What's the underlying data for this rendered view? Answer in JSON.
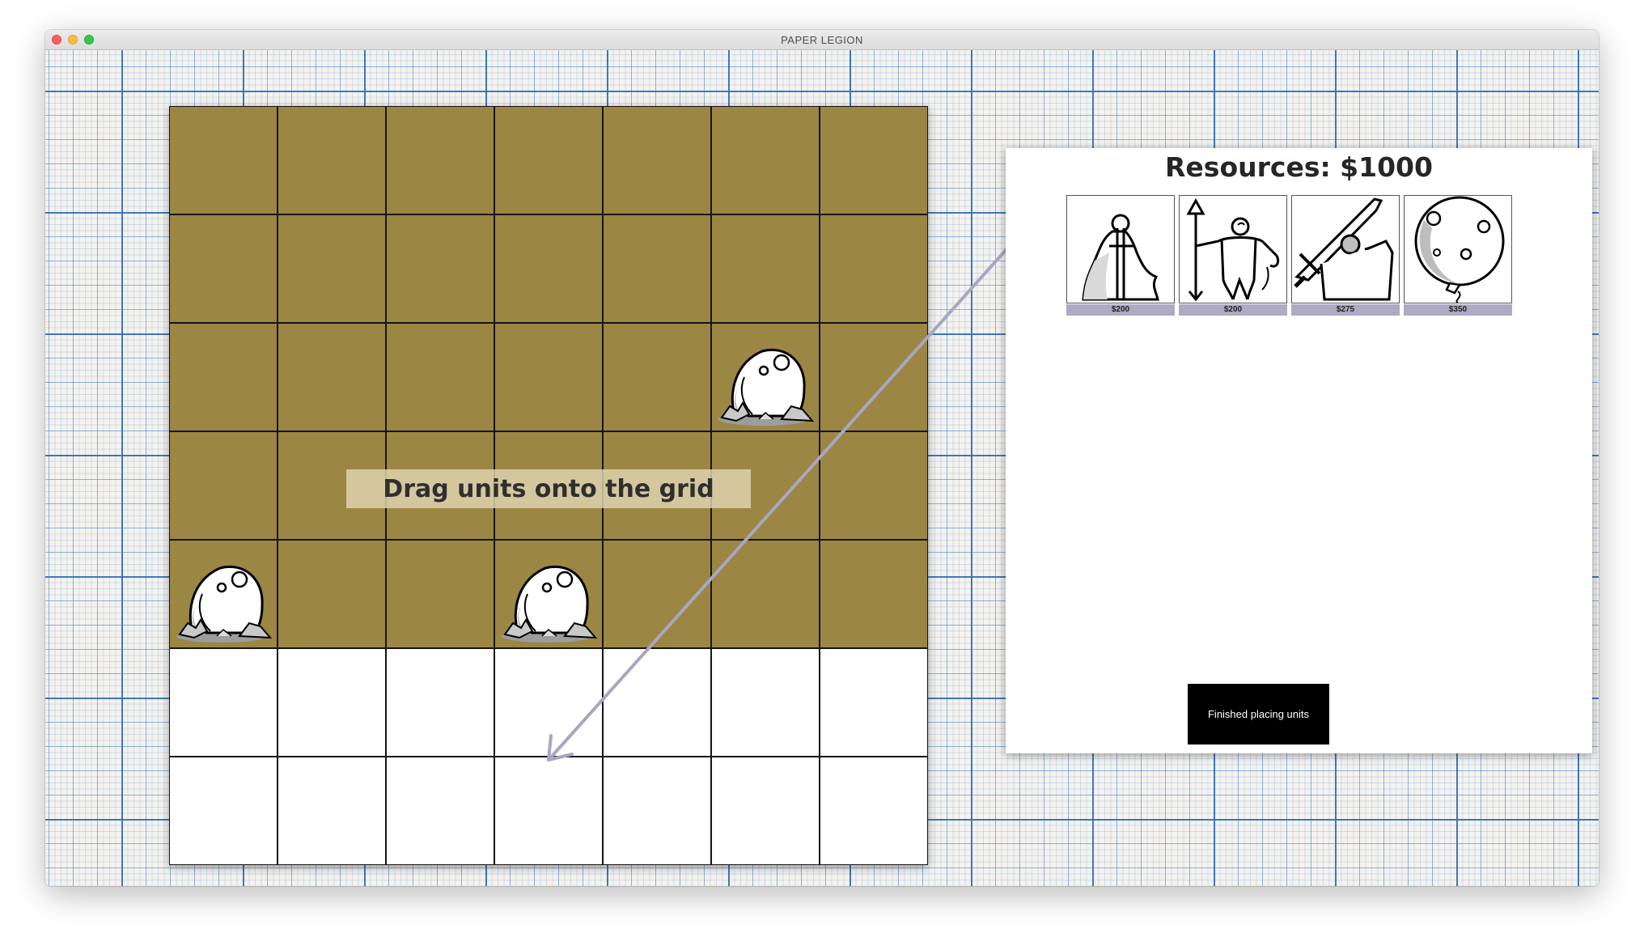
{
  "window": {
    "title": "PAPER LEGION"
  },
  "board": {
    "rows": 7,
    "cols": 7,
    "enemy_rows": 5,
    "player_rows": 2,
    "colors": {
      "enemy_zone": "#9b8643",
      "player_zone": "#ffffff",
      "grid_line": "#151515"
    },
    "enemy_units": [
      {
        "type": "boulder",
        "row": 3,
        "col": 6
      },
      {
        "type": "boulder",
        "row": 5,
        "col": 1
      },
      {
        "type": "boulder",
        "row": 5,
        "col": 4
      }
    ],
    "instruction": "Drag units onto the grid"
  },
  "panel": {
    "resources_label": "Resources: $1000",
    "shop": [
      {
        "unit": "knight-icon",
        "price": "$200"
      },
      {
        "unit": "spearman-icon",
        "price": "$200"
      },
      {
        "unit": "swordsman-icon",
        "price": "$275"
      },
      {
        "unit": "boulder-icon",
        "price": "$350"
      }
    ],
    "finish_label": "Finished placing units"
  },
  "colors": {
    "price_bar": "#aeaac4",
    "hint_arrow": "#a9a6c3",
    "button_bg": "#000000"
  }
}
